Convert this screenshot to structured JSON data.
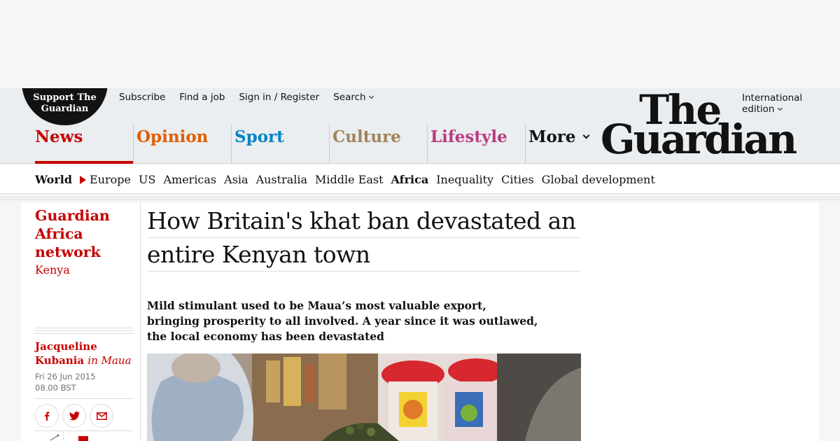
{
  "masthead": {
    "support": [
      "Support The",
      "Guardian"
    ],
    "top_links": [
      "Subscribe",
      "Find a job",
      "Sign in / Register",
      "Search"
    ],
    "edition": [
      "International",
      "edition"
    ],
    "logo": [
      "The",
      "Guardian"
    ],
    "pillars": [
      {
        "label": "News",
        "color": "#c70000"
      },
      {
        "label": "Opinion",
        "color": "#e05e00"
      },
      {
        "label": "Sport",
        "color": "#0084c6"
      },
      {
        "label": "Culture",
        "color": "#a1845c"
      },
      {
        "label": "Lifestyle",
        "color": "#bb3b80"
      },
      {
        "label": "More",
        "color": "#121212"
      }
    ]
  },
  "subnav": {
    "items": [
      "World",
      "Europe",
      "US",
      "Americas",
      "Asia",
      "Australia",
      "Middle East",
      "Africa",
      "Inequality",
      "Cities",
      "Global development"
    ]
  },
  "article": {
    "series": "Guardian Africa network",
    "tag": "Kenya",
    "byline_name": "Jacqueline Kubania",
    "byline_location": "in Maua",
    "date": "Fri 26 Jun 2015",
    "time": "08.00 BST",
    "headline_lines": [
      "How Britain's khat ban devastated an",
      "entire Kenyan town"
    ],
    "standfirst": "Mild stimulant used to be Maua’s most valuable export, bringing prosperity to all involved. A year since it was outlawed, the local economy has been devastated"
  },
  "share": {
    "icons": [
      "facebook-icon",
      "twitter-icon",
      "email-icon"
    ]
  },
  "colors": {
    "brand_red": "#c70000",
    "masthead_bg": "#eaeef0"
  }
}
